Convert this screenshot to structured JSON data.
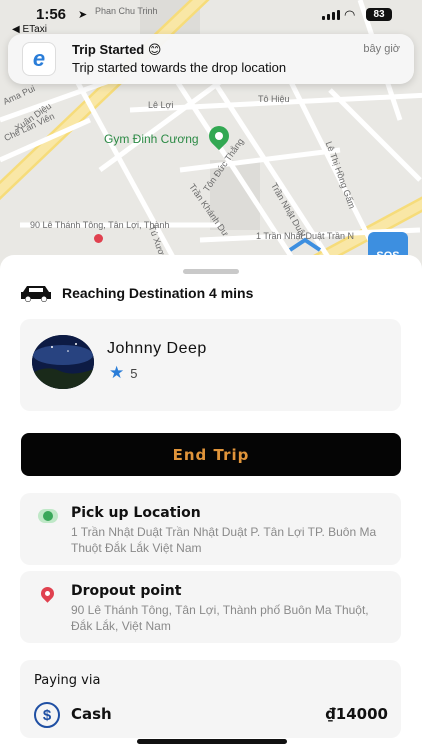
{
  "status_bar": {
    "time": "1:56",
    "back_app": "◀ ETaxi",
    "battery": "83"
  },
  "notification": {
    "app_icon_letter": "e",
    "title": "Trip Started 😊",
    "body": "Trip started towards the drop location",
    "time": "bây giờ"
  },
  "map": {
    "poi": "Gym Đinh Cương",
    "streets": [
      "Phan Chu Trinh",
      "Lê Lợi",
      "Tô Hiệu",
      "Xuân Diệu",
      "Ama Pui",
      "Chế Lan Viên",
      "Tôn Đức Thắng",
      "Trần Khánh Dư",
      "Trần Nhật Duật",
      "Lê Thị Hồng Gấm",
      "Tú Xương"
    ],
    "bottom_labels": [
      "90 Lê Thánh Tông, Tân Lợi, Thành",
      "1 Trần Nhật Duật Trần N"
    ],
    "sos_label": "SOS"
  },
  "trip": {
    "status_text": "Reaching Destination 4 mins",
    "driver": {
      "name": "Johnny Deep",
      "rating": "5"
    },
    "end_button": "End Trip",
    "pickup": {
      "title": "Pick up Location",
      "address": "1 Trần Nhật Duật Trần Nhật Duật P. Tân Lợi TP. Buôn Ma Thuột Đắk Lắk Việt Nam"
    },
    "dropoff": {
      "title": "Dropout point",
      "address": "90 Lê Thánh Tông, Tân Lợi, Thành phố Buôn Ma Thuột, Đắk Lắk, Việt Nam"
    },
    "payment": {
      "label": "Paying via",
      "method": "Cash",
      "amount": "₫14000"
    }
  },
  "colors": {
    "end_button_bg": "#050505",
    "end_button_text": "#e0943a",
    "pickup_dot": "#3aa75a",
    "drop_pin": "#e0414f",
    "poi": "#32a852"
  },
  "icons": [
    "car-icon",
    "star-icon",
    "pickup-dot-icon",
    "drop-pin-icon",
    "dollar-icon",
    "map-pin-icon",
    "location-arrow-icon",
    "wifi-icon"
  ]
}
